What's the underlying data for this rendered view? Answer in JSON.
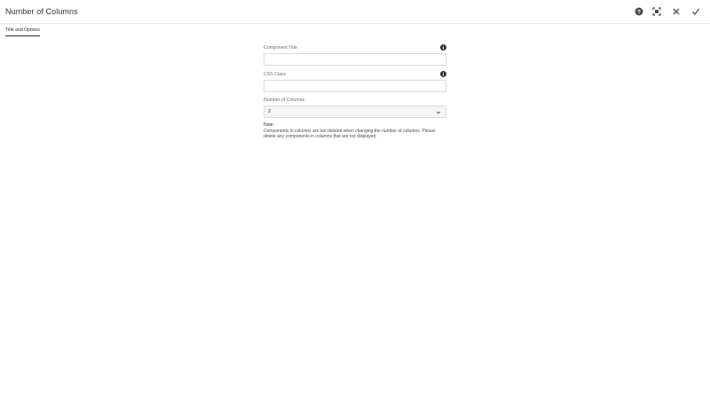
{
  "dialog": {
    "title": "Number of Columns",
    "buttons": {
      "help": "help-icon",
      "fullscreen": "fullscreen-icon",
      "close": "close-icon",
      "done": "checkmark-icon"
    }
  },
  "tabs": [
    {
      "label": "Title and Options",
      "selected": true
    }
  ],
  "form": {
    "component_title": {
      "label": "Component Title",
      "value": "",
      "placeholder": ""
    },
    "css_class": {
      "label": "CSS Class",
      "value": "",
      "placeholder": ""
    },
    "columns": {
      "label": "Number of Columns",
      "selected": "2"
    },
    "note": {
      "title": "Note:",
      "line1": "Components in columns are not deleted when changing the number of columns. Please",
      "line2": "delete any components in columns that are not displayed."
    }
  },
  "colors": {
    "accent": "#2c2c2c",
    "border": "#dadada",
    "select_bg": "#f5f5f5"
  }
}
